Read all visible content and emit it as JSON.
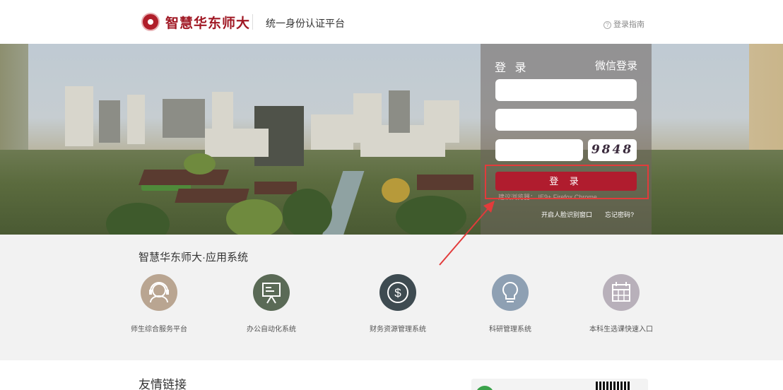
{
  "header": {
    "logo_text": "智慧华东师大",
    "platform_title": "统一身份认证平台",
    "help_label": "登录指南",
    "help_icon": "question-circle-icon"
  },
  "login": {
    "title": "登 录",
    "wechat_label": "微信登录",
    "username_value": "",
    "password_value": "",
    "captcha_input_value": "",
    "captcha_text": "9848",
    "submit_label": "登 录",
    "browser_tip": "建议浏览器：",
    "browser_list": "IE9+  Firefox  Chrome",
    "face_window_label": "开启人脸识别窗口",
    "forgot_label": "忘记密码?"
  },
  "apps": {
    "title": "智慧华东师大·应用系统",
    "items": [
      {
        "label": "师生综合服务平台",
        "icon": "headset-support-icon"
      },
      {
        "label": "办公自动化系统",
        "icon": "presentation-board-icon"
      },
      {
        "label": "财务资源管理系统",
        "icon": "dollar-coin-icon"
      },
      {
        "label": "科研管理系统",
        "icon": "lightbulb-icon"
      },
      {
        "label": "本科生选课快速入口",
        "icon": "calendar-grid-icon"
      }
    ]
  },
  "links": {
    "title": "友情链接"
  },
  "colors": {
    "brand_red": "#b01c2e",
    "highlight_red": "#e23b3b"
  }
}
